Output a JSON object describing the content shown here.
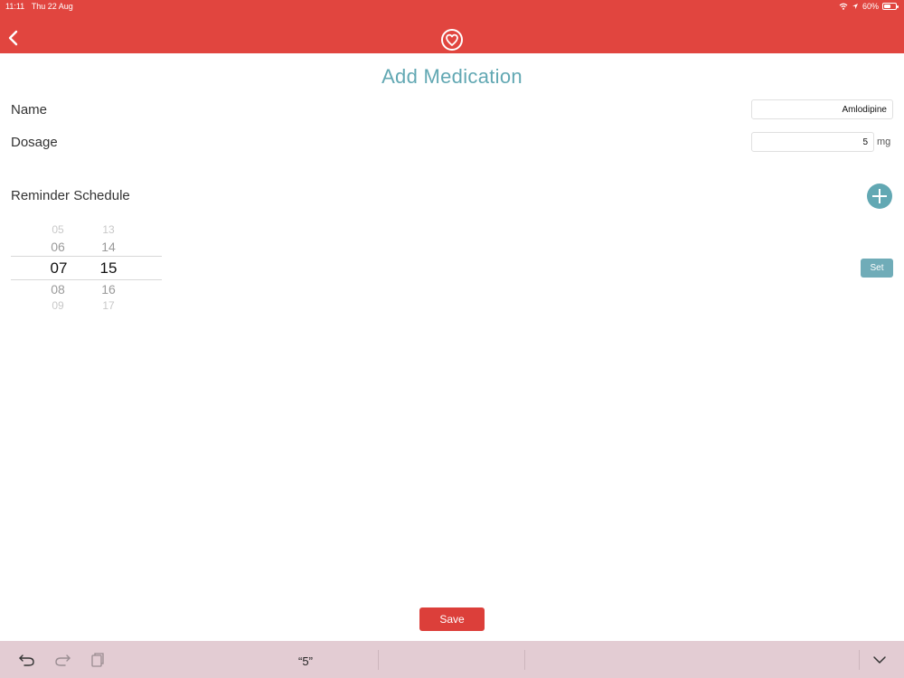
{
  "status_bar": {
    "time": "11:11",
    "date": "Thu 22 Aug",
    "battery": "60%",
    "battery_level": 0.6
  },
  "header": {
    "back_icon": "chevron-left-icon",
    "logo_icon": "heart-circle-icon",
    "bg_color": "#e1453f"
  },
  "page": {
    "title": "Add Medication"
  },
  "form": {
    "name_label": "Name",
    "name_value": "Amlodipine",
    "dosage_label": "Dosage",
    "dosage_value": "5",
    "dosage_unit": "mg"
  },
  "reminder": {
    "label": "Reminder Schedule",
    "add_icon": "plus-icon",
    "hours": [
      "05",
      "06",
      "07",
      "08",
      "09"
    ],
    "minutes": [
      "13",
      "14",
      "15",
      "16",
      "17"
    ],
    "selected_hour": "07",
    "selected_minute": "15",
    "set_label": "Set"
  },
  "actions": {
    "save_label": "Save",
    "save_color": "#dc3f3a"
  },
  "keyboard_bar": {
    "suggestion": "“5”",
    "undo_icon": "undo-icon",
    "redo_icon": "redo-icon",
    "paste_icon": "clipboard-icon",
    "dismiss_icon": "chevron-down-icon"
  },
  "colors": {
    "accent": "#62a8b3",
    "header": "#e1453f"
  }
}
